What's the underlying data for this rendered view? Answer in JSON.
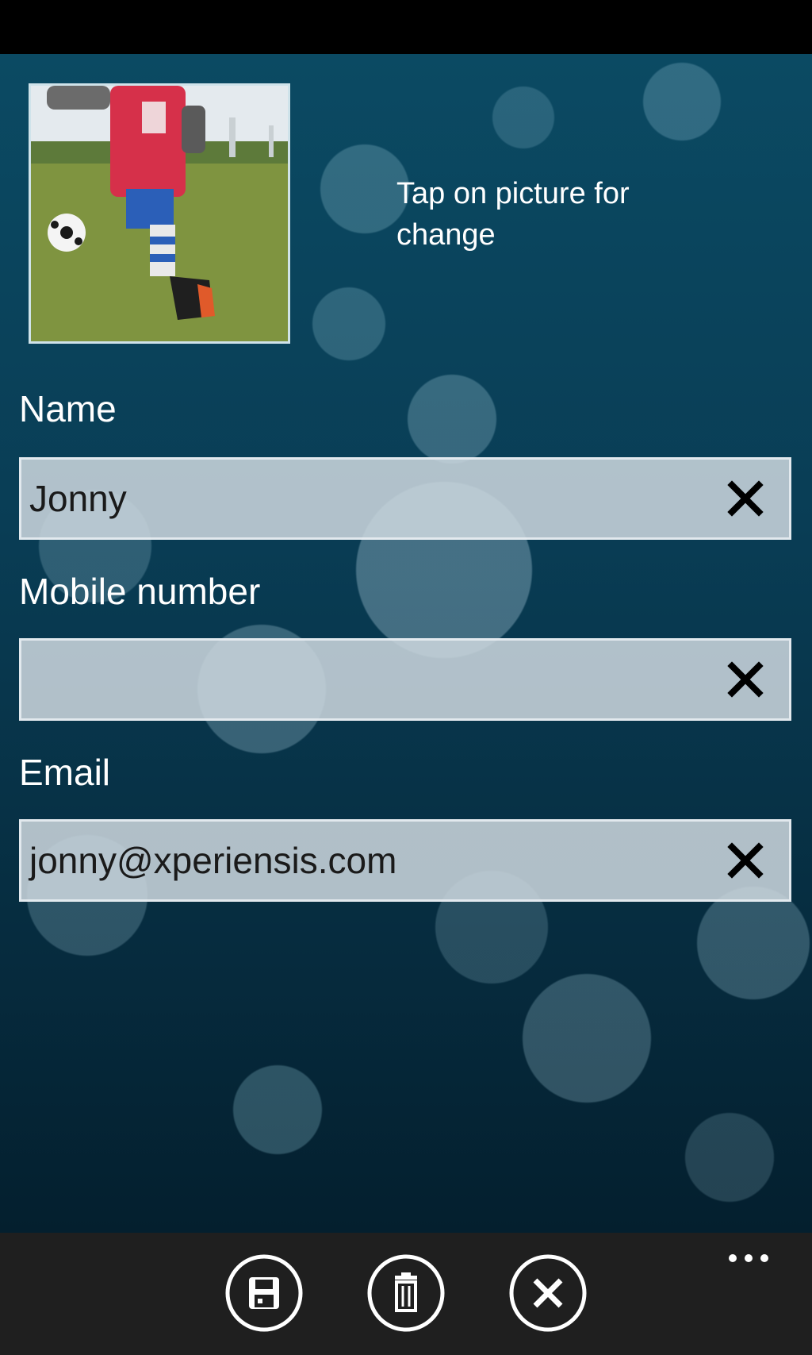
{
  "profile": {
    "tap_hint": "Tap on picture for change"
  },
  "form": {
    "name": {
      "label": "Name",
      "value": "Jonny"
    },
    "mobile": {
      "label": "Mobile number",
      "value": ""
    },
    "email": {
      "label": "Email",
      "value": "jonny@xperiensis.com"
    }
  },
  "app_bar": {
    "buttons": [
      {
        "icon": "save-icon"
      },
      {
        "icon": "delete-icon"
      },
      {
        "icon": "cancel-icon"
      }
    ],
    "more": "..."
  },
  "colors": {
    "background_top": "#0b4a63",
    "background_bottom": "#041f2e",
    "field_bg": "#cdd7de",
    "app_bar_bg": "#1f1f1f"
  }
}
